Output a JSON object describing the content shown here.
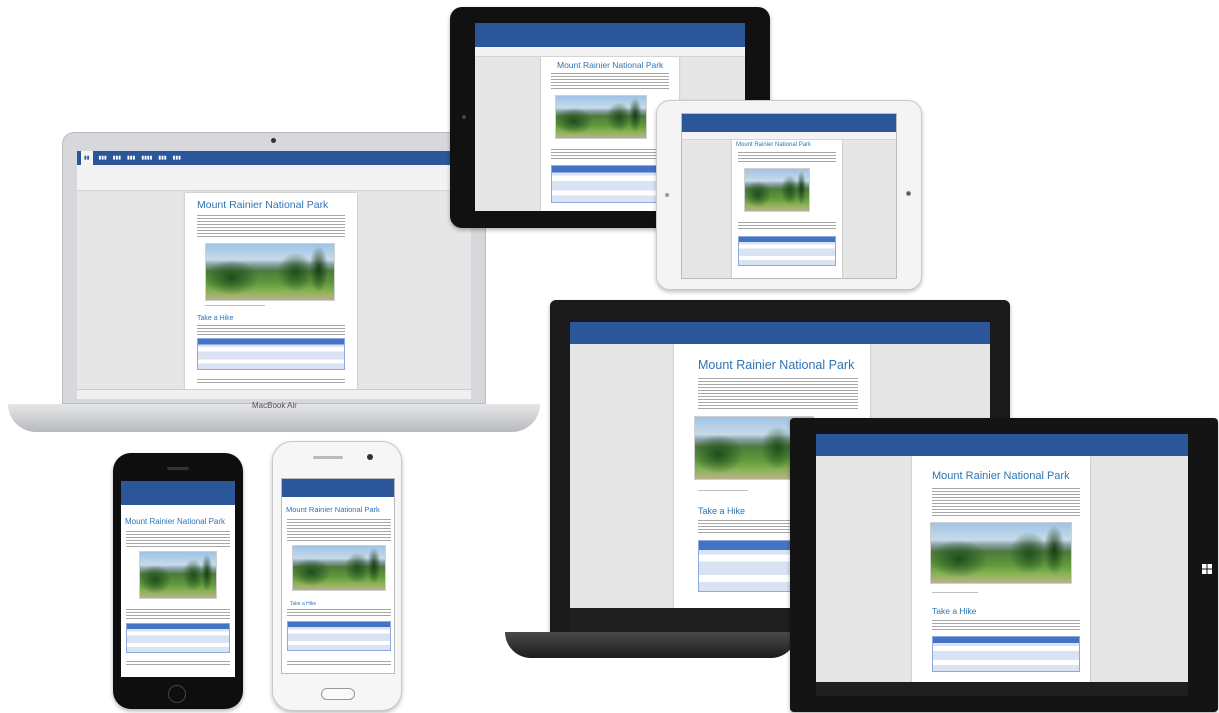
{
  "document": {
    "title": "Mount Rainier National Park",
    "section_heading": "Take a Hike"
  },
  "devices": {
    "macbook_label": "MacBook Air"
  },
  "icons": {
    "windows_logo": "windows-logo-icon",
    "camera": "camera-icon",
    "home_button": "home-button-icon"
  },
  "colors": {
    "word_blue": "#2b579a",
    "heading_blue": "#2e74b5",
    "table_header": "#4472c4"
  }
}
